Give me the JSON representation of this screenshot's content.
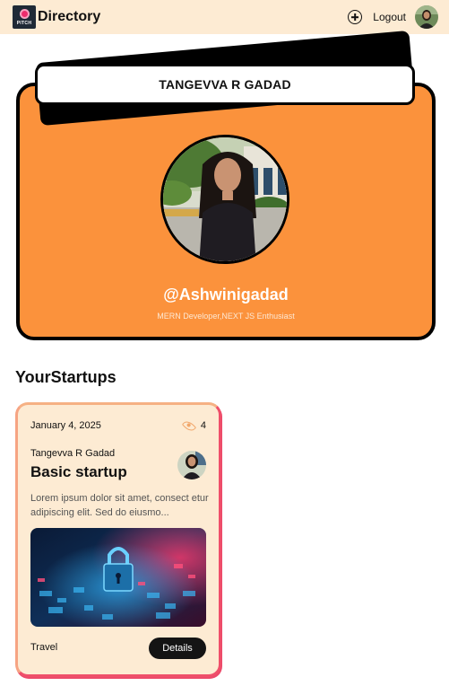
{
  "navbar": {
    "logo_text": "PITCH",
    "brand": "Directory",
    "logout_label": "Logout",
    "icons": {
      "create": "plus-circle-icon",
      "avatar": "user-avatar"
    }
  },
  "profile": {
    "name": "TANGEVVA R GADAD",
    "username": "@Ashwinigadad",
    "bio": "MERN Developer,NEXT JS Enthusiast",
    "card_color": "#fb923c"
  },
  "section": {
    "title": "YourStartups"
  },
  "startups": [
    {
      "date": "January 4, 2025",
      "views": "4",
      "author": "Tangevva R Gadad",
      "title": "Basic startup",
      "description": "Lorem ipsum dolor sit amet, consect etur adipiscing elit. Sed do eiusmo...",
      "category": "Travel",
      "details_label": "Details",
      "image_icon": "cyber-lock-image"
    }
  ],
  "colors": {
    "navbar_bg": "#fdebd3",
    "card_bg": "#fdebd3",
    "accent": "#ef4f6a"
  }
}
